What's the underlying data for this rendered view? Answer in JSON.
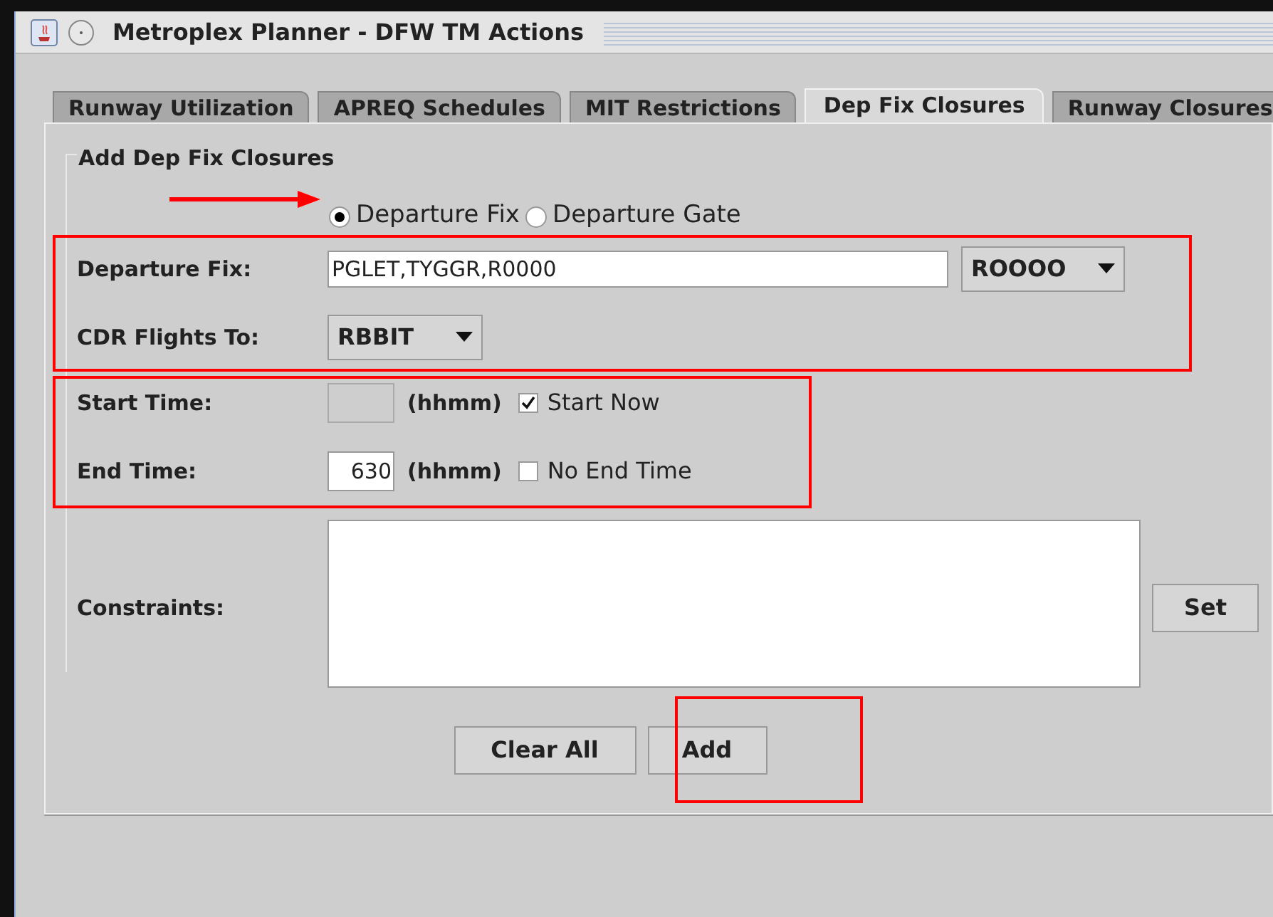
{
  "window": {
    "title": "Metroplex Planner - DFW TM Actions"
  },
  "tabs": [
    {
      "label": "Runway Utilization",
      "selected": false
    },
    {
      "label": "APREQ Schedules",
      "selected": false
    },
    {
      "label": "MIT Restrictions",
      "selected": false
    },
    {
      "label": "Dep Fix Closures",
      "selected": true
    },
    {
      "label": "Runway Closures",
      "selected": false
    }
  ],
  "group": {
    "title": "Add Dep Fix Closures"
  },
  "mode_options": [
    {
      "label": "Departure Fix",
      "selected": true
    },
    {
      "label": "Departure Gate",
      "selected": false
    }
  ],
  "departure_fix": {
    "label": "Departure Fix:",
    "value": "PGLET,TYGGR,R0000",
    "dropdown": "ROOOO"
  },
  "cdr_flights_to": {
    "label": "CDR Flights To:",
    "dropdown": "RBBIT"
  },
  "start_time": {
    "label": "Start Time:",
    "disabled": true,
    "unit": "(hhmm)",
    "checkbox": {
      "label": "Start Now",
      "checked": true
    }
  },
  "end_time": {
    "label": "End Time:",
    "disabled": false,
    "value": "630",
    "unit": "(hhmm)",
    "checkbox": {
      "label": "No End Time",
      "checked": false
    }
  },
  "constraints": {
    "label": "Constraints:",
    "button": "Set"
  },
  "buttons": [
    "Clear All",
    "Add"
  ]
}
